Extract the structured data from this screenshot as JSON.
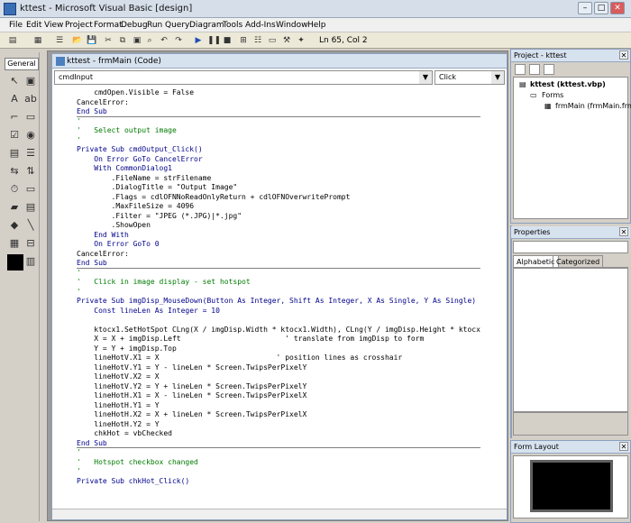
{
  "window": {
    "title": "kttest - Microsoft Visual Basic [design]",
    "min": "–",
    "max": "□",
    "close": "✕"
  },
  "menu": [
    "File",
    "Edit",
    "View",
    "Project",
    "Format",
    "Debug",
    "Run",
    "Query",
    "Diagram",
    "Tools",
    "Add-Ins",
    "Window",
    "Help"
  ],
  "toolbar": {
    "position_label": "Ln 65, Col 2"
  },
  "toolbox": {
    "header": "General"
  },
  "code_window": {
    "title": "kttest - frmMain (Code)",
    "object_combo": "cmdInput",
    "procedure_combo": "Click",
    "lines": [
      "    cmdOpen.Visible = False",
      "CancelError:",
      "End Sub",
      "'",
      "'   Select output image",
      "'",
      "Private Sub cmdOutput_Click()",
      "    On Error GoTo CancelError",
      "    With CommonDialog1",
      "        .FileName = strFilename",
      "        .DialogTitle = \"Output Image\"",
      "        .Flags = cdlOFNNoReadOnlyReturn + cdlOFNOverwritePrompt",
      "        .MaxFileSize = 4096",
      "        .Filter = \"JPEG (*.JPG)|*.jpg\"",
      "        .ShowOpen",
      "    End With",
      "    On Error GoTo 0",
      "CancelError:",
      "End Sub",
      "'",
      "'   Click in image display - set hotspot",
      "'",
      "Private Sub imgDisp_MouseDown(Button As Integer, Shift As Integer, X As Single, Y As Single)",
      "    Const lineLen As Integer = 10",
      "",
      "    ktocx1.SetHotSpot CLng(X / imgDisp.Width * ktocx1.Width), CLng(Y / imgDisp.Height * ktocx",
      "    X = X + imgDisp.Left                        ' translate from imgDisp to form",
      "    Y = Y + imgDisp.Top",
      "    lineHotV.X1 = X                           ' position lines as crosshair",
      "    lineHotV.Y1 = Y - lineLen * Screen.TwipsPerPixelY",
      "    lineHotV.X2 = X",
      "    lineHotV.Y2 = Y + lineLen * Screen.TwipsPerPixelY",
      "    lineHotH.X1 = X - lineLen * Screen.TwipsPerPixelX",
      "    lineHotH.Y1 = Y",
      "    lineHotH.X2 = X + lineLen * Screen.TwipsPerPixelX",
      "    lineHotH.Y2 = Y",
      "    chkHot = vbChecked",
      "End Sub",
      "'",
      "'   Hotspot checkbox changed",
      "'",
      "Private Sub chkHot_Click()"
    ]
  },
  "project": {
    "title": "Project - kttest",
    "root": "kttest (kttest.vbp)",
    "forms_folder": "Forms",
    "form_item": "frmMain (frmMain.frm)"
  },
  "properties": {
    "title": "Properties",
    "tab_alpha": "Alphabetic",
    "tab_cat": "Categorized"
  },
  "form_layout": {
    "title": "Form Layout"
  },
  "colors": {
    "keyword": "#00008b",
    "comment": "#007a00"
  }
}
